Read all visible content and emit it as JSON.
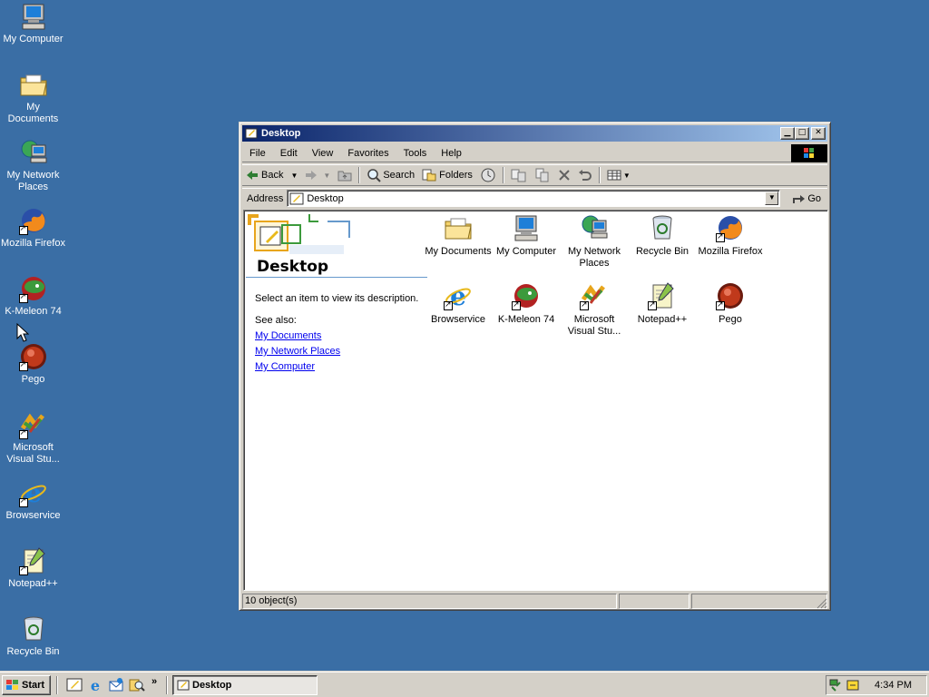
{
  "desktop": {
    "icons": [
      {
        "label": "My Computer",
        "icon": "computer-icon"
      },
      {
        "label": "My Documents",
        "icon": "folder-documents-icon"
      },
      {
        "label": "My Network Places",
        "icon": "network-places-icon"
      },
      {
        "label": "Mozilla Firefox",
        "icon": "firefox-icon"
      },
      {
        "label": "K-Meleon 74",
        "icon": "kmeleon-icon"
      },
      {
        "label": "Pego",
        "icon": "pego-icon"
      },
      {
        "label": "Microsoft Visual Stu...",
        "icon": "visual-studio-icon"
      },
      {
        "label": "Browservice",
        "icon": "ie-icon"
      },
      {
        "label": "Notepad++",
        "icon": "notepadpp-icon"
      },
      {
        "label": "Recycle Bin",
        "icon": "recycle-bin-icon"
      }
    ]
  },
  "window": {
    "title": "Desktop",
    "menu": [
      "File",
      "Edit",
      "View",
      "Favorites",
      "Tools",
      "Help"
    ],
    "toolbar": {
      "back": "Back",
      "search": "Search",
      "folders": "Folders"
    },
    "address": {
      "label": "Address",
      "value": "Desktop",
      "go": "Go"
    },
    "left_pane": {
      "title": "Desktop",
      "description": "Select an item to view its description.",
      "see_also": "See also:",
      "links": [
        "My Documents",
        "My Network Places",
        "My Computer"
      ]
    },
    "items": [
      {
        "label": "My Documents",
        "icon": "folder-documents-icon"
      },
      {
        "label": "My Computer",
        "icon": "computer-icon"
      },
      {
        "label": "My Network Places",
        "icon": "network-places-icon"
      },
      {
        "label": "Recycle Bin",
        "icon": "recycle-bin-icon"
      },
      {
        "label": "Mozilla Firefox",
        "icon": "firefox-icon"
      },
      {
        "label": "Browservice",
        "icon": "ie-icon"
      },
      {
        "label": "K-Meleon 74",
        "icon": "kmeleon-icon"
      },
      {
        "label": "Microsoft Visual Stu...",
        "icon": "visual-studio-icon"
      },
      {
        "label": "Notepad++",
        "icon": "notepadpp-icon"
      },
      {
        "label": "Pego",
        "icon": "pego-icon"
      }
    ],
    "status": "10 object(s)"
  },
  "taskbar": {
    "start": "Start",
    "task": "Desktop",
    "clock": "4:34 PM"
  },
  "colors": {
    "desktop": "#3a6ea5",
    "titlebar_start": "#0a246a",
    "titlebar_end": "#a6caf0",
    "face": "#d4d0c8"
  }
}
